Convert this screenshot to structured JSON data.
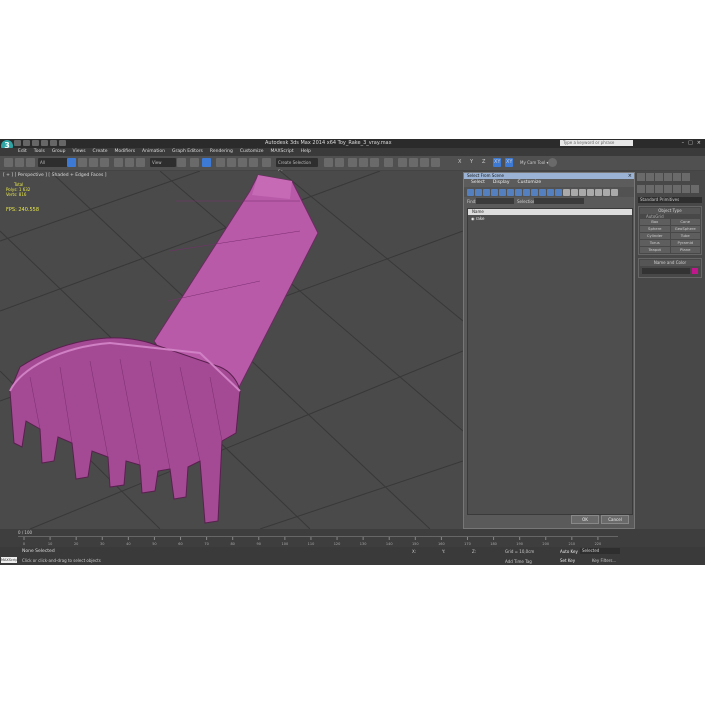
{
  "app": {
    "title": "Autodesk 3ds Max  2014 x64     Toy_Rake_3_vray.max",
    "search_placeholder": "Type a keyword or phrase",
    "logo": "3"
  },
  "menu": [
    "Edit",
    "Tools",
    "Group",
    "Views",
    "Create",
    "Modifiers",
    "Animation",
    "Graph Editors",
    "Rendering",
    "Customize",
    "MAXScript",
    "Help"
  ],
  "toolbar": {
    "filter": "All",
    "view": "View",
    "axes": [
      "X",
      "Y",
      "Z",
      "XY",
      "XY"
    ],
    "camera": "My Cam Tool ▾",
    "selset": "Create Selection Se"
  },
  "viewport": {
    "label": "[ + ] [ Perspective ] [ Shaded + Edged Faces ]",
    "stats": [
      "Total",
      "Polys:   1 632",
      "Verts:   816"
    ],
    "fps_label": "FPS:",
    "fps": "240.558"
  },
  "dialog": {
    "title": "Select From Scene",
    "menu": [
      "Select",
      "Display",
      "Customize"
    ],
    "find_label": "Find:",
    "selset_label": "Selection Set:",
    "column": "Name",
    "items": [
      "rake"
    ],
    "ok": "OK",
    "cancel": "Cancel"
  },
  "command_panel": {
    "category": "Standard Primitives",
    "object_type": "Object Type",
    "autogrid": "AutoGrid",
    "primitives": [
      "Box",
      "Cone",
      "Sphere",
      "GeoSphere",
      "Cylinder",
      "Tube",
      "Torus",
      "Pyramid",
      "Teapot",
      "Plane"
    ],
    "name_color": "Name and Color",
    "swatch_color": "#c0188c"
  },
  "timeline": {
    "frame": "0 / 100",
    "ticks": [
      "0",
      "10",
      "20",
      "30",
      "40",
      "50",
      "60",
      "70",
      "80",
      "90",
      "100",
      "110",
      "120",
      "130",
      "140",
      "150",
      "160",
      "170",
      "180",
      "190",
      "200",
      "210",
      "220"
    ]
  },
  "status": {
    "maxscript": "MAXScript",
    "selected": "None Selected",
    "prompt": "Click or click-and-drag to select objects",
    "x": "X:",
    "y": "Y:",
    "z": "Z:",
    "grid": "Grid = 10,0cm",
    "autokey": "Auto Key",
    "setkey": "Set Key",
    "selected_mode": "Selected",
    "keyfilters": "Key Filters...",
    "addtag": "Add Time Tag"
  }
}
